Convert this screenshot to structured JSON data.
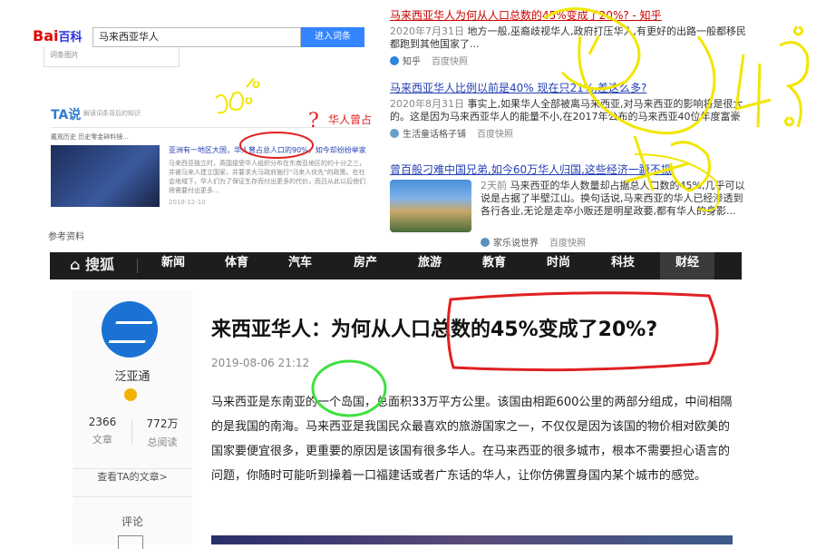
{
  "baike": {
    "logo_red": "Bai",
    "logo_blue": "百科",
    "search_value": "马来西亚华人",
    "search_button": "进入词条",
    "dropdown_text": "词条图片",
    "ta_logo": "TA说",
    "ta_subtitle": "解读词条背后的知识",
    "ta_row": "戴观历史  历史零金碎料镜...",
    "article_title": "亚洲有一地区大国，华人曾占总人口的90%，如今却纷纷举家",
    "article_desc": "马来西亚独立时，英国接受华人组织分布在东南亚地区的约十分之三，并被马来人建立国家，并要求大马政府施行\"马来人优先\"的政策。在社会地域下，华人们为了保证生存而付出更多的代价，而且从此以后他们将需要付出更多...",
    "article_date": "2018-12-10",
    "reference": "参考资料"
  },
  "results": [
    {
      "title": "马来西亚华人为何从人口总数的45%变成了20%? - 知乎",
      "date": "2020年7月31日",
      "body": "地方一般,巫裔歧视华人,政府打压华人,有更好的出路一般都移民都跑到其他国家了...",
      "source": "知乎",
      "snapshot": "百度快照"
    },
    {
      "title": "马来西亚华人比例以前是40% 现在只21%,差这么多?",
      "date": "2020年8月31日",
      "body": "事实上,如果华人全部被离马来西亚,对马来西亚的影响将是很大的。这是因为马来西亚华人的能量不小,在2017年公布的马来西亚40位年度富豪中,华人富豪占了...",
      "source": "生活童话格子铺",
      "snapshot": "百度快照"
    },
    {
      "title": "曾百般刁难中国兄弟,如今60万华人归国,这些经济一蹶不振",
      "date": "2天前",
      "body": "马来西亚的华人数量却占据总人口数的45%,几乎可以说是占据了半壁江山。换句话说,马来西亚的华人已经渗透到各行各业,无论是走卒小贩还是明星政要,都有华人的身影...",
      "source": "家乐说世界",
      "snapshot": "百度快照"
    }
  ],
  "nav": {
    "logo": "搜狐",
    "items": [
      "新闻",
      "体育",
      "汽车",
      "房产",
      "旅游",
      "教育",
      "时尚",
      "科技",
      "财经"
    ],
    "active_index": 8
  },
  "author": {
    "name": "泛亚通",
    "articles_count": "2366",
    "articles_label": "文章",
    "reads_count": "772万",
    "reads_label": "总阅读",
    "more_link": "查看TA的文章>",
    "comment_label": "评论"
  },
  "article": {
    "title": "来西亚华人：为何从人口总数的45%变成了20%?",
    "date": "2019-08-06 21:12",
    "paragraph": "马来西亚是东南亚的一个岛国，总面积33万平方公里。该国由相距600公里的两部分组成，中间相隔的是我国的南海。马来西亚是我国民众最喜欢的旅游国家之一，不仅仅是因为该国的物价相对欧美的国家要便宜很多，更重要的原因是该国有很多华人。在马来西亚的很多城市，根本不需要担心语言的问题，你随时可能听到操着一口福建话或者广东话的华人，让你仿佛置身国内某个城市的感觉。"
  },
  "annotations": {
    "red_text": "华人曾占",
    "question": "?",
    "colors": {
      "red": "#e02020",
      "yellow": "#f2e600",
      "green": "#3ee03e"
    }
  }
}
